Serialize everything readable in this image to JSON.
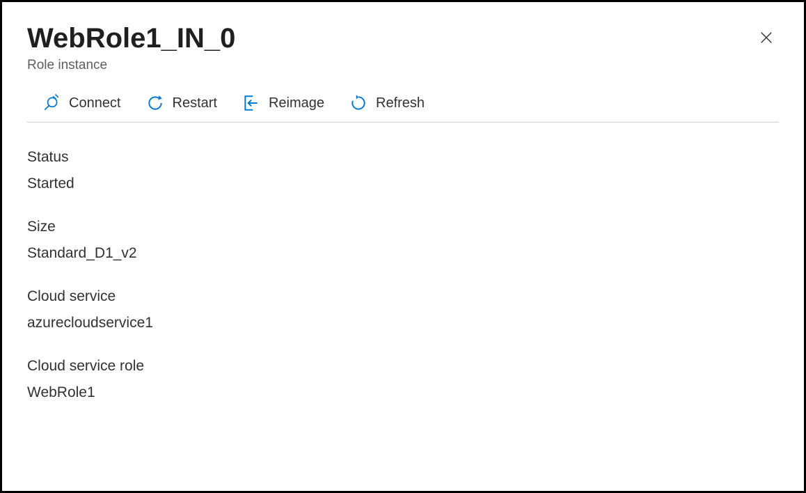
{
  "header": {
    "title": "WebRole1_IN_0",
    "subtitle": "Role instance"
  },
  "toolbar": {
    "connect": "Connect",
    "restart": "Restart",
    "reimage": "Reimage",
    "refresh": "Refresh"
  },
  "fields": {
    "status": {
      "label": "Status",
      "value": "Started"
    },
    "size": {
      "label": "Size",
      "value": "Standard_D1_v2"
    },
    "cloudService": {
      "label": "Cloud service",
      "value": "azurecloudservice1"
    },
    "cloudServiceRole": {
      "label": "Cloud service role",
      "value": "WebRole1"
    }
  }
}
